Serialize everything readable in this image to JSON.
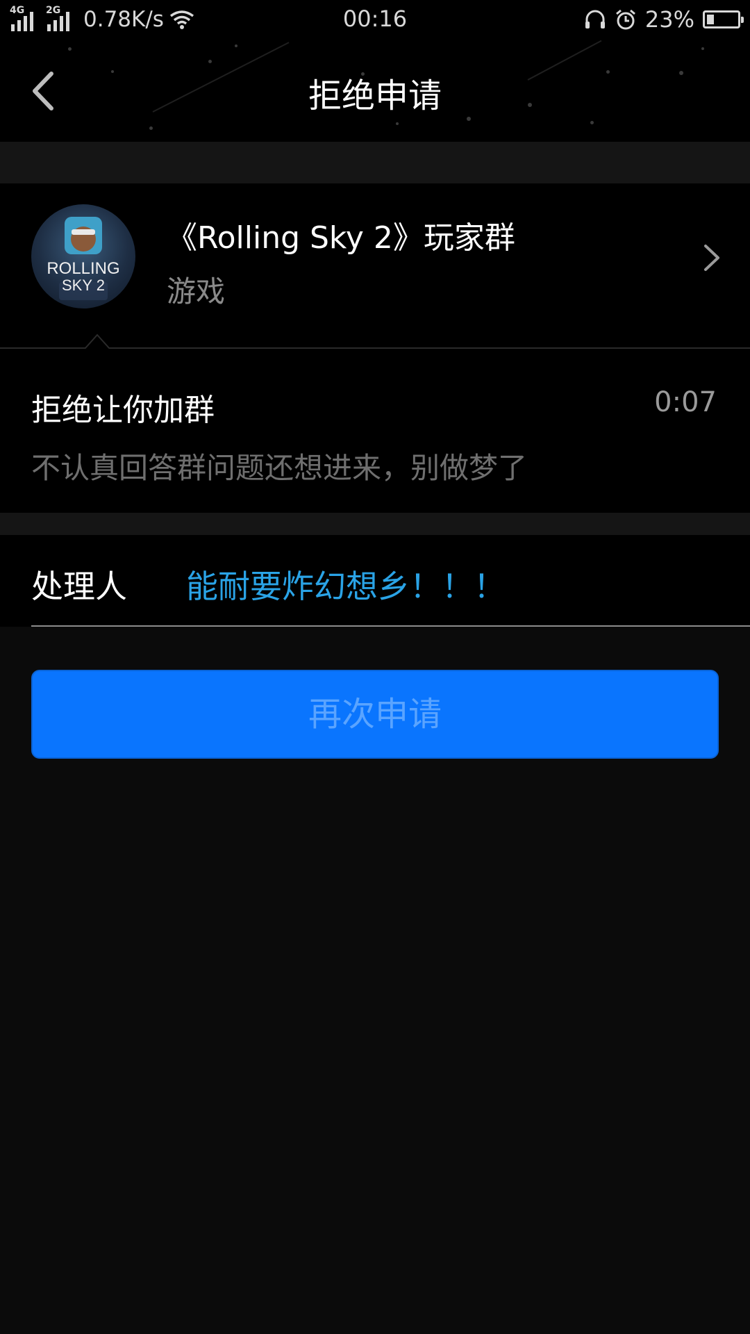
{
  "status_bar": {
    "net1": "4G",
    "net2": "2G",
    "speed": "0.78K/s",
    "time": "00:16",
    "battery_text": "23%",
    "battery_level": 0.23,
    "icons": [
      "signal-icon",
      "wifi-icon",
      "headphone-icon",
      "alarm-icon",
      "battery-icon"
    ]
  },
  "header": {
    "title": "拒绝申请"
  },
  "group": {
    "name": "《Rolling Sky 2》玩家群",
    "category": "游戏",
    "avatar_text_line1": "ROLLING",
    "avatar_text_line2": "SKY 2"
  },
  "rejection": {
    "title": "拒绝让你加群",
    "time": "0:07",
    "message": "不认真回答群问题还想进来，别做梦了"
  },
  "handler": {
    "label": "处理人",
    "name": "能耐要炸幻想乡！！！"
  },
  "actions": {
    "reapply_label": "再次申请"
  },
  "colors": {
    "accent_blue": "#0a75fe",
    "link_blue": "#2aa3e6",
    "background": "#0b0b0b"
  }
}
